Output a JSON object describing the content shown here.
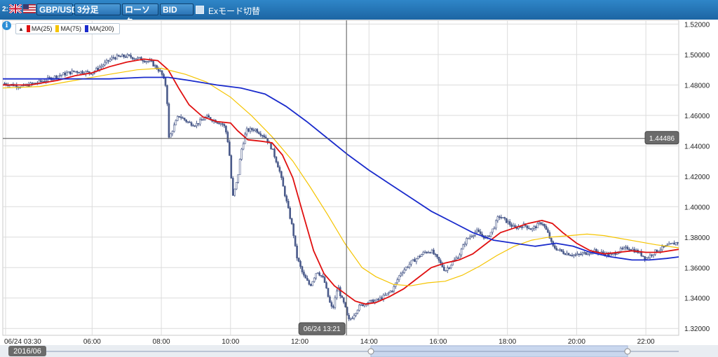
{
  "toolbar": {
    "prefix": "2:",
    "symbol": "GBP/USD",
    "timeframe": "3分足",
    "chart_style": "ローソク",
    "price_type": "BID",
    "ex_mode_label": "Exモード切替"
  },
  "legend": {
    "toggle": "▲",
    "items": [
      {
        "label": "MA(25)",
        "color": "#e01010"
      },
      {
        "label": "MA(75)",
        "color": "#f5c400"
      },
      {
        "label": "MA(200)",
        "color": "#1a2bcc"
      }
    ]
  },
  "crosshair": {
    "price_label": "1.44486",
    "time_label": "06/24 13:21",
    "price": 1.44486,
    "time": 13.35
  },
  "date_label": "2016/06",
  "chart_data": {
    "type": "candlestick",
    "title": "",
    "x_tick_labels": [
      "06/24 03:30",
      "06:00",
      "08:00",
      "10:00",
      "12:00",
      "14:00",
      "16:00",
      "18:00",
      "20:00",
      "22:00"
    ],
    "x_ticks": [
      3.5,
      6,
      8,
      10,
      12,
      14,
      16,
      18,
      20,
      22
    ],
    "y_tick_labels": [
      "1.52000",
      "1.50000",
      "1.48000",
      "1.46000",
      "1.44000",
      "1.42000",
      "1.40000",
      "1.38000",
      "1.36000",
      "1.34000",
      "1.32000"
    ],
    "ylim": [
      1.3155,
      1.5225
    ],
    "xlim": [
      3.42,
      22.95
    ],
    "grid": true,
    "price_path": [
      [
        3.42,
        1.481
      ],
      [
        4.0,
        1.479
      ],
      [
        4.5,
        1.482
      ],
      [
        5.0,
        1.486
      ],
      [
        5.5,
        1.489
      ],
      [
        6.0,
        1.488
      ],
      [
        6.3,
        1.493
      ],
      [
        6.6,
        1.498
      ],
      [
        7.0,
        1.499
      ],
      [
        7.4,
        1.497
      ],
      [
        7.7,
        1.495
      ],
      [
        8.0,
        1.488
      ],
      [
        8.15,
        1.478
      ],
      [
        8.22,
        1.445
      ],
      [
        8.35,
        1.452
      ],
      [
        8.5,
        1.46
      ],
      [
        8.8,
        1.455
      ],
      [
        9.0,
        1.454
      ],
      [
        9.3,
        1.459
      ],
      [
        9.6,
        1.456
      ],
      [
        9.8,
        1.454
      ],
      [
        9.9,
        1.447
      ],
      [
        10.0,
        1.428
      ],
      [
        10.05,
        1.405
      ],
      [
        10.2,
        1.418
      ],
      [
        10.3,
        1.436
      ],
      [
        10.45,
        1.45
      ],
      [
        10.7,
        1.451
      ],
      [
        11.0,
        1.446
      ],
      [
        11.2,
        1.438
      ],
      [
        11.4,
        1.425
      ],
      [
        11.6,
        1.405
      ],
      [
        11.8,
        1.385
      ],
      [
        11.9,
        1.368
      ],
      [
        12.1,
        1.355
      ],
      [
        12.3,
        1.348
      ],
      [
        12.5,
        1.358
      ],
      [
        12.7,
        1.352
      ],
      [
        12.85,
        1.338
      ],
      [
        12.95,
        1.332
      ],
      [
        13.1,
        1.348
      ],
      [
        13.2,
        1.34
      ],
      [
        13.3,
        1.335
      ],
      [
        13.4,
        1.325
      ],
      [
        13.5,
        1.327
      ],
      [
        13.7,
        1.334
      ],
      [
        13.9,
        1.337
      ],
      [
        14.2,
        1.338
      ],
      [
        14.5,
        1.342
      ],
      [
        14.7,
        1.346
      ],
      [
        14.9,
        1.356
      ],
      [
        15.2,
        1.363
      ],
      [
        15.6,
        1.37
      ],
      [
        15.8,
        1.371
      ],
      [
        16.0,
        1.365
      ],
      [
        16.2,
        1.358
      ],
      [
        16.4,
        1.363
      ],
      [
        16.6,
        1.368
      ],
      [
        16.8,
        1.378
      ],
      [
        17.1,
        1.384
      ],
      [
        17.4,
        1.379
      ],
      [
        17.6,
        1.386
      ],
      [
        17.75,
        1.394
      ],
      [
        18.0,
        1.39
      ],
      [
        18.2,
        1.386
      ],
      [
        18.5,
        1.388
      ],
      [
        18.7,
        1.385
      ],
      [
        19.0,
        1.39
      ],
      [
        19.2,
        1.381
      ],
      [
        19.3,
        1.374
      ],
      [
        19.6,
        1.37
      ],
      [
        20.0,
        1.368
      ],
      [
        20.5,
        1.371
      ],
      [
        21.0,
        1.368
      ],
      [
        21.2,
        1.371
      ],
      [
        21.5,
        1.373
      ],
      [
        21.8,
        1.37
      ],
      [
        22.0,
        1.366
      ],
      [
        22.3,
        1.371
      ],
      [
        22.6,
        1.374
      ],
      [
        22.95,
        1.377
      ]
    ],
    "series": [
      {
        "name": "MA(25)",
        "color": "#e01010",
        "points": [
          [
            3.42,
            1.48
          ],
          [
            4.2,
            1.48
          ],
          [
            5.0,
            1.483
          ],
          [
            5.5,
            1.486
          ],
          [
            6.0,
            1.488
          ],
          [
            6.5,
            1.492
          ],
          [
            7.0,
            1.495
          ],
          [
            7.5,
            1.497
          ],
          [
            7.9,
            1.496
          ],
          [
            8.2,
            1.49
          ],
          [
            8.5,
            1.478
          ],
          [
            8.8,
            1.467
          ],
          [
            9.2,
            1.459
          ],
          [
            9.6,
            1.456
          ],
          [
            10.0,
            1.455
          ],
          [
            10.2,
            1.45
          ],
          [
            10.5,
            1.444
          ],
          [
            10.9,
            1.443
          ],
          [
            11.2,
            1.442
          ],
          [
            11.5,
            1.434
          ],
          [
            11.8,
            1.419
          ],
          [
            12.1,
            1.395
          ],
          [
            12.4,
            1.371
          ],
          [
            12.7,
            1.356
          ],
          [
            13.0,
            1.348
          ],
          [
            13.3,
            1.343
          ],
          [
            13.6,
            1.338
          ],
          [
            13.9,
            1.336
          ],
          [
            14.2,
            1.337
          ],
          [
            14.6,
            1.341
          ],
          [
            15.0,
            1.346
          ],
          [
            15.4,
            1.353
          ],
          [
            15.8,
            1.36
          ],
          [
            16.2,
            1.363
          ],
          [
            16.6,
            1.365
          ],
          [
            17.0,
            1.369
          ],
          [
            17.4,
            1.376
          ],
          [
            17.8,
            1.383
          ],
          [
            18.2,
            1.386
          ],
          [
            18.6,
            1.389
          ],
          [
            19.0,
            1.391
          ],
          [
            19.3,
            1.389
          ],
          [
            19.6,
            1.383
          ],
          [
            20.0,
            1.376
          ],
          [
            20.4,
            1.371
          ],
          [
            20.8,
            1.369
          ],
          [
            21.2,
            1.37
          ],
          [
            21.6,
            1.371
          ],
          [
            22.0,
            1.37
          ],
          [
            22.4,
            1.37
          ],
          [
            22.95,
            1.372
          ]
        ]
      },
      {
        "name": "MA(75)",
        "color": "#f5c400",
        "points": [
          [
            3.42,
            1.478
          ],
          [
            4.5,
            1.479
          ],
          [
            5.5,
            1.483
          ],
          [
            6.5,
            1.487
          ],
          [
            7.3,
            1.49
          ],
          [
            8.0,
            1.491
          ],
          [
            8.7,
            1.487
          ],
          [
            9.3,
            1.482
          ],
          [
            10.0,
            1.472
          ],
          [
            10.6,
            1.46
          ],
          [
            11.2,
            1.446
          ],
          [
            11.8,
            1.43
          ],
          [
            12.3,
            1.413
          ],
          [
            12.8,
            1.395
          ],
          [
            13.3,
            1.376
          ],
          [
            13.8,
            1.36
          ],
          [
            14.2,
            1.354
          ],
          [
            14.7,
            1.349
          ],
          [
            15.2,
            1.348
          ],
          [
            15.7,
            1.35
          ],
          [
            16.2,
            1.351
          ],
          [
            16.7,
            1.355
          ],
          [
            17.2,
            1.361
          ],
          [
            17.7,
            1.368
          ],
          [
            18.2,
            1.374
          ],
          [
            18.7,
            1.378
          ],
          [
            19.2,
            1.38
          ],
          [
            19.8,
            1.381
          ],
          [
            20.3,
            1.382
          ],
          [
            20.8,
            1.381
          ],
          [
            21.3,
            1.379
          ],
          [
            21.8,
            1.377
          ],
          [
            22.3,
            1.375
          ],
          [
            22.95,
            1.373
          ]
        ]
      },
      {
        "name": "MA(200)",
        "color": "#1a2bcc",
        "points": [
          [
            3.42,
            1.484
          ],
          [
            5.0,
            1.484
          ],
          [
            6.5,
            1.484
          ],
          [
            7.5,
            1.485
          ],
          [
            8.2,
            1.485
          ],
          [
            8.8,
            1.483
          ],
          [
            9.6,
            1.48
          ],
          [
            10.3,
            1.478
          ],
          [
            11.0,
            1.474
          ],
          [
            11.6,
            1.466
          ],
          [
            12.2,
            1.456
          ],
          [
            12.8,
            1.445
          ],
          [
            13.4,
            1.434
          ],
          [
            14.0,
            1.424
          ],
          [
            14.6,
            1.415
          ],
          [
            15.2,
            1.406
          ],
          [
            15.8,
            1.397
          ],
          [
            16.4,
            1.39
          ],
          [
            17.0,
            1.383
          ],
          [
            17.6,
            1.378
          ],
          [
            18.2,
            1.376
          ],
          [
            18.8,
            1.374
          ],
          [
            19.4,
            1.376
          ],
          [
            19.9,
            1.374
          ],
          [
            20.4,
            1.37
          ],
          [
            21.0,
            1.367
          ],
          [
            21.6,
            1.365
          ],
          [
            22.1,
            1.365
          ],
          [
            22.6,
            1.366
          ],
          [
            22.95,
            1.367
          ]
        ]
      }
    ]
  },
  "colors": {
    "grid": "#dcdcdc",
    "candle": "#4a5a8a",
    "crosshair": "#555555",
    "label_bg": "#6b6b6b"
  }
}
